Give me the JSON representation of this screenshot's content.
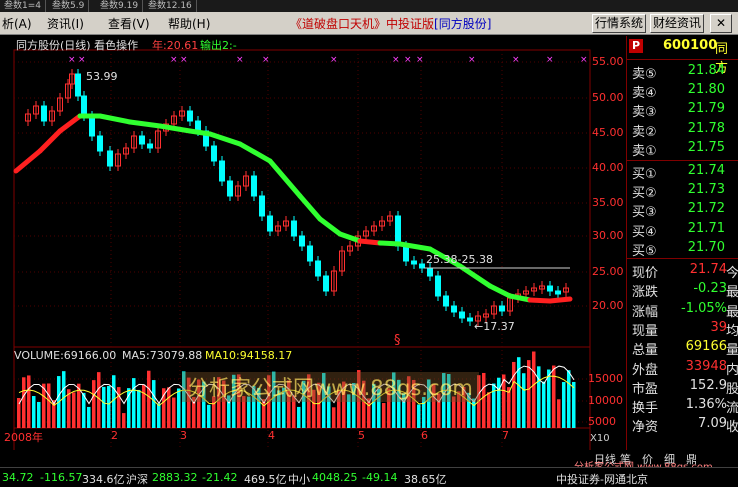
{
  "tabs": [
    "叁数1=4",
    "叁数5.9",
    "叁数9.19",
    "叁数12.16"
  ],
  "menu": {
    "items": [
      "析(A)",
      "资讯(I)",
      "查看(V)",
      "帮助(H)"
    ],
    "title_main": "《道破盘口天机》中投证版",
    "title_bracket": "[同方股份]",
    "buttons": [
      "行情系统",
      "财经资讯"
    ],
    "close_glyph": "✕",
    "min_glyph": "–"
  },
  "chart": {
    "stock_title": "同方股份(日线) 看色操作",
    "year_label": "年:20.61",
    "output_label": "输出2:-",
    "peak_label": "53.99",
    "mid_label": "25.38-25.38",
    "low_label": "←17.37",
    "marker_glyph": "§",
    "volume_label": "VOLUME:69166.00",
    "ma5_label": "MA5:73079.88",
    "ma10_label": "MA10:94158.17",
    "watermark": "分析家公式网www.88gs.com",
    "unit_label": "X10",
    "price_ticks": [
      "55.00",
      "50.00",
      "45.00",
      "40.00",
      "35.00",
      "30.00",
      "25.00",
      "20.00"
    ],
    "vol_ticks": [
      "15000",
      "10000",
      "5000"
    ],
    "date_labels": [
      "2008年",
      "2",
      "3",
      "4",
      "5",
      "6",
      "7"
    ],
    "bottom_tabs": [
      "日线",
      "笔",
      "价",
      "细",
      "鼎"
    ],
    "watermark2": "分析家公式网 www.88gs.com"
  },
  "panel": {
    "flag": "P",
    "code": "600100",
    "name": "同方",
    "asks": [
      {
        "label": "卖⑤",
        "value": "21.84"
      },
      {
        "label": "卖④",
        "value": "21.80"
      },
      {
        "label": "卖③",
        "value": "21.79"
      },
      {
        "label": "卖②",
        "value": "21.78"
      },
      {
        "label": "卖①",
        "value": "21.75"
      }
    ],
    "bids": [
      {
        "label": "买①",
        "value": "21.74"
      },
      {
        "label": "买②",
        "value": "21.73"
      },
      {
        "label": "买③",
        "value": "21.72"
      },
      {
        "label": "买④",
        "value": "21.71"
      },
      {
        "label": "买⑤",
        "value": "21.70"
      }
    ],
    "stats": [
      {
        "label": "现价",
        "value": "21.74",
        "right": "今",
        "color": "#ff3030"
      },
      {
        "label": "涨跌",
        "value": "-0.23",
        "right": "最",
        "color": "#30ff30"
      },
      {
        "label": "涨幅",
        "value": "-1.05%",
        "right": "最",
        "color": "#30ff30"
      },
      {
        "label": "现量",
        "value": "39",
        "right": "均",
        "color": "#ff3030"
      },
      {
        "label": "总量",
        "value": "69166",
        "right": "量",
        "color": "#ffff30"
      },
      {
        "label": "外盘",
        "value": "33948",
        "right": "内",
        "color": "#ff3030"
      },
      {
        "label": "市盈",
        "value": "152.9",
        "right": "股",
        "color": "#e0e0e0"
      },
      {
        "label": "换手",
        "value": "1.36%",
        "right": "流",
        "color": "#e0e0e0"
      },
      {
        "label": "净资",
        "value": "7.09",
        "right": "收",
        "color": "#e0e0e0"
      }
    ]
  },
  "status": {
    "idx1": "34.72",
    "idx1_chg": "-116.57",
    "idx1_amt": "334.6亿",
    "idx2_name": "沪深",
    "idx2": "2883.32",
    "idx2_chg": "-21.42",
    "idx2_amt": "469.5亿",
    "idx3_name": "中小",
    "idx3": "4048.25",
    "idx3_chg": "-49.14",
    "idx3_amt": "38.65亿",
    "broker": "中投证券-网通北京"
  },
  "colors": {
    "up": "#ff3030",
    "down": "#00ffff",
    "green": "#30ff30",
    "accent": "#c00000"
  }
}
